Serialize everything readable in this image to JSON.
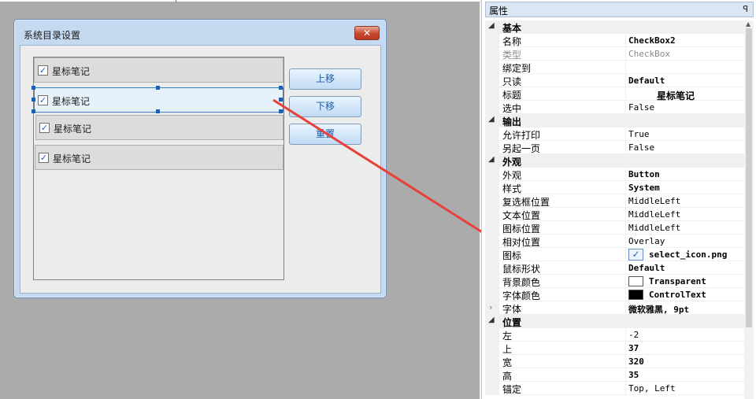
{
  "dialog": {
    "title": "系统目录设置",
    "close_glyph": "✕",
    "rows": [
      {
        "label": "星标笔记"
      },
      {
        "label": "星标笔记"
      },
      {
        "label": "星标笔记"
      },
      {
        "label": "星标笔记"
      }
    ],
    "buttons": {
      "up": "上移",
      "down": "下移",
      "reset": "重置"
    }
  },
  "properties": {
    "title": "属性",
    "pin_glyph": "ꟼ",
    "categories": [
      {
        "name": "基本",
        "items": [
          {
            "name": "名称",
            "value": "CheckBox2"
          },
          {
            "name": "类型",
            "value": "CheckBox"
          },
          {
            "name": "绑定到",
            "value": ""
          },
          {
            "name": "只读",
            "value": "Default"
          },
          {
            "name": "标题",
            "value": "星标笔记"
          },
          {
            "name": "选中",
            "value": "False"
          }
        ]
      },
      {
        "name": "输出",
        "items": [
          {
            "name": "允许打印",
            "value": "True"
          },
          {
            "name": "另起一页",
            "value": "False"
          }
        ]
      },
      {
        "name": "外观",
        "items": [
          {
            "name": "外观",
            "value": "Button"
          },
          {
            "name": "样式",
            "value": "System"
          },
          {
            "name": "复选框位置",
            "value": "MiddleLeft"
          },
          {
            "name": "文本位置",
            "value": "MiddleLeft"
          },
          {
            "name": "图标位置",
            "value": "MiddleLeft"
          },
          {
            "name": "相对位置",
            "value": "Overlay"
          },
          {
            "name": "图标",
            "value": "select_icon.png"
          },
          {
            "name": "鼠标形状",
            "value": "Default"
          },
          {
            "name": "背景颜色",
            "value": "Transparent",
            "color": "#ffffff"
          },
          {
            "name": "字体颜色",
            "value": "ControlText",
            "color": "#000000"
          },
          {
            "name": "字体",
            "value": "微软雅黑, 9pt"
          }
        ]
      },
      {
        "name": "位置",
        "items": [
          {
            "name": "左",
            "value": "-2"
          },
          {
            "name": "上",
            "value": "37"
          },
          {
            "name": "宽",
            "value": "320"
          },
          {
            "name": "高",
            "value": "35"
          },
          {
            "name": "锚定",
            "value": "Top, Left"
          }
        ]
      }
    ]
  },
  "colors": {
    "arrow": "#e8403a",
    "selection": "#1f5fb0"
  }
}
